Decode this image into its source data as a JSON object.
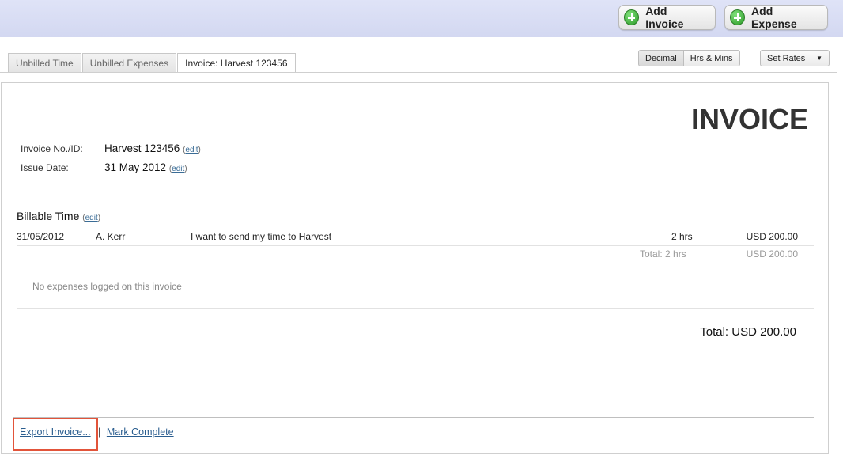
{
  "header": {
    "add_invoice_label": "Add Invoice",
    "add_expense_label": "Add Expense"
  },
  "tabs": [
    {
      "label": "Unbilled Time"
    },
    {
      "label": "Unbilled Expenses"
    },
    {
      "label": "Invoice: Harvest 123456",
      "active": true
    }
  ],
  "format_toggle": {
    "decimal_label": "Decimal",
    "hrs_mins_label": "Hrs & Mins"
  },
  "set_rates": {
    "label": "Set Rates",
    "icon": "▼"
  },
  "invoice": {
    "title": "INVOICE",
    "number_label": "Invoice No./ID:",
    "number_value": "Harvest 123456",
    "date_label": "Issue Date:",
    "date_value": "31 May 2012",
    "edit_open": "(",
    "edit_label": "edit",
    "edit_close": ")"
  },
  "billable_time": {
    "title": "Billable Time",
    "entries": [
      {
        "date": "31/05/2012",
        "person": "A. Kerr",
        "description": "I want to send my time to Harvest",
        "hours": "2 hrs",
        "amount": "USD 200.00"
      }
    ],
    "total_hours": "Total: 2 hrs",
    "total_amount": "USD 200.00"
  },
  "expenses": {
    "empty_message": "No expenses logged on this invoice"
  },
  "grand_total": "Total: USD 200.00",
  "footer": {
    "export_label": "Export Invoice...",
    "separator": "|",
    "mark_complete_label": "Mark Complete"
  },
  "colors": {
    "highlight": "#e2543a",
    "link": "#2a5d8f",
    "header_band": "#d8dcf4"
  }
}
